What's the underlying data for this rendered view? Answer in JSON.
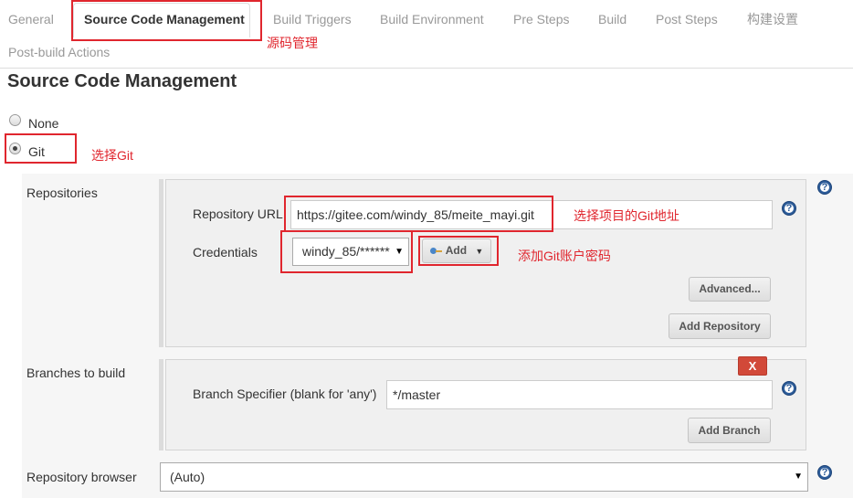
{
  "tabs": [
    "General",
    "Source Code Management",
    "Build Triggers",
    "Build Environment",
    "Pre Steps",
    "Build",
    "Post Steps",
    "构建设置",
    "Post-build Actions"
  ],
  "notes": {
    "scm": "源码管理",
    "git": "选择Git",
    "url": "选择项目的Git地址",
    "cred": "添加Git账户密码"
  },
  "section_title": "Source Code Management",
  "scm_options": {
    "none": "None",
    "git": "Git",
    "selected": "Git"
  },
  "repositories": {
    "label": "Repositories",
    "url_label": "Repository URL",
    "url_value": "https://gitee.com/windy_85/meite_mayi.git",
    "credentials_label": "Credentials",
    "credentials_value": "windy_85/******",
    "add_button": "Add",
    "advanced_button": "Advanced...",
    "add_repository_button": "Add Repository"
  },
  "branches": {
    "label": "Branches to build",
    "delete_button": "X",
    "specifier_label": "Branch Specifier (blank for 'any')",
    "specifier_value": "*/master",
    "add_branch_button": "Add Branch"
  },
  "browser": {
    "label": "Repository browser",
    "value": "(Auto)"
  },
  "help_glyph": "?",
  "colors": {
    "annotation": "#e0262e",
    "help": "#2d5c99",
    "delete": "#d24939"
  }
}
